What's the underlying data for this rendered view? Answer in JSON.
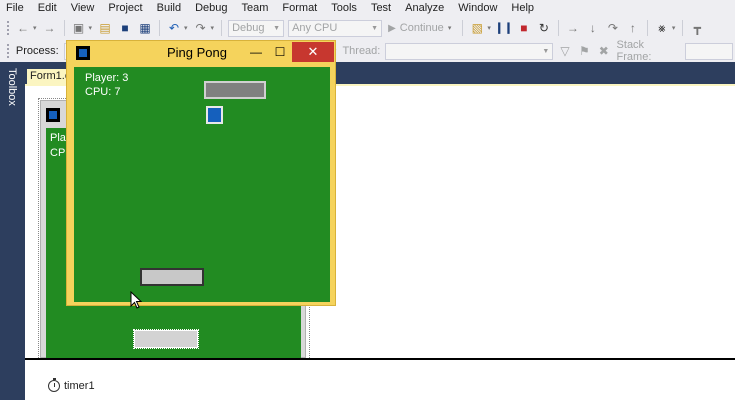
{
  "menu": [
    "File",
    "Edit",
    "View",
    "Project",
    "Build",
    "Debug",
    "Team",
    "Format",
    "Tools",
    "Test",
    "Analyze",
    "Window",
    "Help"
  ],
  "toolbar": {
    "config": "Debug",
    "platform": "Any CPU",
    "continue": "Continue"
  },
  "debug_location": {
    "process_label": "Process:",
    "thread_label": "Thread:",
    "stack_frame_label": "Stack Frame:"
  },
  "toolbox_label": "Toolbox",
  "document_tab": "Form1.cs [Design]",
  "design_form": {
    "player_label": "Player:",
    "cpu_label": "CPU:"
  },
  "component_tray": {
    "item": "timer1"
  },
  "app_window": {
    "title": "Ping Pong",
    "player_score": "Player: 3",
    "cpu_score": "CPU: 7",
    "minimize_glyph": "—",
    "maximize_glyph": "☐",
    "close_glyph": "✕"
  },
  "colors": {
    "game_background": "#228b22",
    "ball": "#1560bd",
    "title_bar": "#f5d35c",
    "close_button": "#c7372f",
    "tab_active": "#fbf5c1",
    "chrome_dark": "#2d3e5e"
  }
}
